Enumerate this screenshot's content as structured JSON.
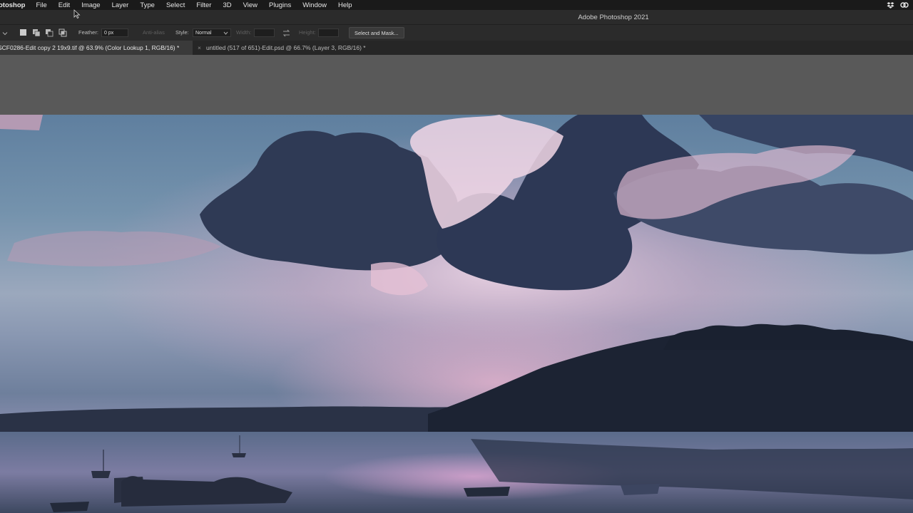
{
  "menubar": {
    "app_name": "otoshop",
    "items": [
      "File",
      "Edit",
      "Image",
      "Layer",
      "Type",
      "Select",
      "Filter",
      "3D",
      "View",
      "Plugins",
      "Window",
      "Help"
    ]
  },
  "window": {
    "title": "Adobe Photoshop 2021"
  },
  "options": {
    "feather_label": "Feather:",
    "feather_value": "0 px",
    "antialias_label": "Anti-alias",
    "style_label": "Style:",
    "style_value": "Normal",
    "width_label": "Width:",
    "height_label": "Height:",
    "select_mask_label": "Select and Mask..."
  },
  "tabs": [
    {
      "label": "SCF0286-Edit copy 2 19x9.tif @ 63.9% (Color Lookup 1, RGB/16) *"
    },
    {
      "label": "untitled (517 of 651)-Edit.psd @ 66.7% (Layer 3, RGB/16) *"
    }
  ],
  "icons": [
    "dropbox-icon",
    "creative-cloud-icon",
    "close-icon",
    "swap-icon",
    "chevron-down-icon",
    "cursor-icon"
  ]
}
